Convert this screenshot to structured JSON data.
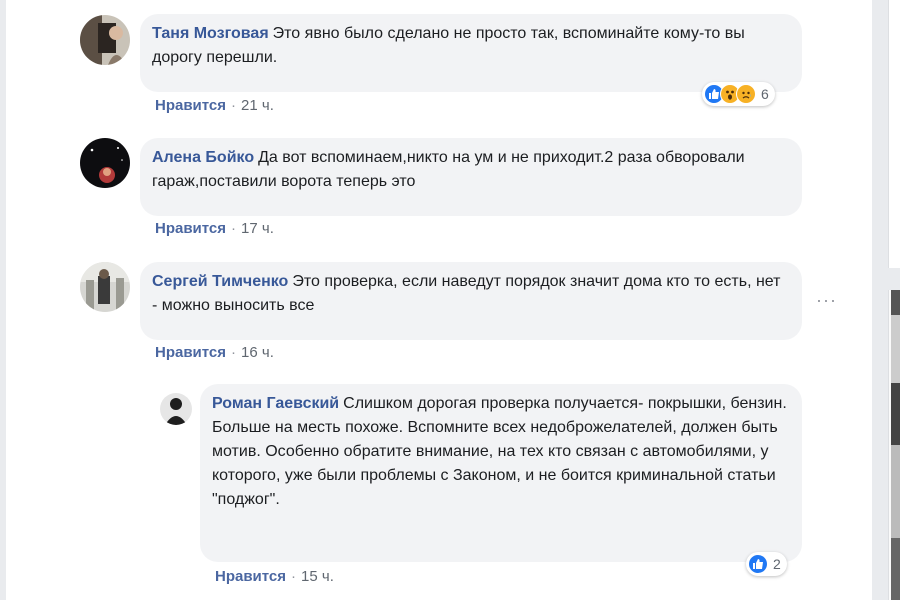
{
  "comments": [
    {
      "author": "Таня Мозговая",
      "text": "Это явно было сделано не просто так, вспоминайте кому-то вы дорогу перешли.",
      "like_label": "Нравится",
      "time": "21 ч.",
      "reactions": {
        "icons": [
          "like-icon",
          "wow-icon",
          "sad-icon"
        ],
        "count": "6"
      }
    },
    {
      "author": "Алена Бойко",
      "text": "Да вот вспоминаем,никто на ум и не приходит.2 раза обворовали гараж,поставили ворота теперь это",
      "like_label": "Нравится",
      "time": "17 ч."
    },
    {
      "author": "Сергей Тимченко",
      "text": "Это проверка, если наведут порядок значит дома кто то есть, нет - можно выносить все",
      "like_label": "Нравится",
      "time": "16 ч.",
      "more_icon": "more-horizontal-icon"
    }
  ],
  "reply": {
    "author": "Роман Гаевский",
    "text": "Слишком дорогая проверка получается- покрышки, бензин. Больше на месть похоже. Вспомните всех недоброжелателей, должен быть мотив. Особенно обратите внимание, на тех кто связан с автомобилями, у которого, уже были проблемы с Законом, и не боится криминальной статьи \"поджог\".",
    "like_label": "Нравится",
    "time": "15 ч.",
    "reactions": {
      "icons": [
        "like-icon"
      ],
      "count": "2"
    }
  },
  "separator": "·",
  "colors": {
    "author": "#385898",
    "bubble": "#f2f3f5",
    "like_blue": "#2078f4",
    "reaction_yellow": "#f7b125"
  }
}
